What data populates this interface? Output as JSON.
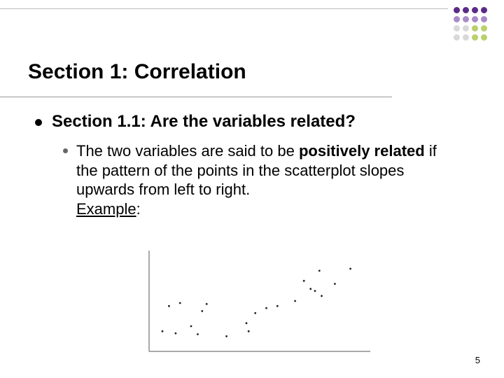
{
  "decoration": {
    "colors_by_row": [
      [
        "#5b2a86",
        "#5b2a86",
        "#5b2a86",
        "#5b2a86"
      ],
      [
        "#a98bc7",
        "#a98bc7",
        "#a98bc7",
        "#a98bc7"
      ],
      [
        "#d9d9d9",
        "#d9d9d9",
        "#b9d16b",
        "#b9d16b"
      ],
      [
        "#d9d9d9",
        "#d9d9d9",
        "#b9d16b",
        "#b9d16b"
      ]
    ]
  },
  "title": "Section 1: Correlation",
  "content": {
    "lvl1": "Section 1.1: Are the variables related?",
    "lvl2_plain1": "The two variables are said to be ",
    "lvl2_bold": "positively related",
    "lvl2_plain2": " if the pattern of the points in the scatterplot slopes upwards from left to right.",
    "lvl2_example": "Example"
  },
  "page_number": "5",
  "chart_data": {
    "type": "scatter",
    "title": "",
    "xlabel": "",
    "ylabel": "",
    "xlim": [
      0,
      100
    ],
    "ylim": [
      0,
      100
    ],
    "series": [
      {
        "name": "points",
        "x": [
          6,
          9,
          12,
          14,
          19,
          22,
          24,
          26,
          35,
          45,
          44,
          48,
          53,
          58,
          66,
          70,
          73,
          75,
          77,
          78,
          84,
          91
        ],
        "y": [
          20,
          45,
          18,
          48,
          25,
          17,
          40,
          47,
          15,
          20,
          28,
          38,
          43,
          45,
          50,
          70,
          62,
          60,
          80,
          55,
          67,
          82
        ]
      }
    ]
  }
}
